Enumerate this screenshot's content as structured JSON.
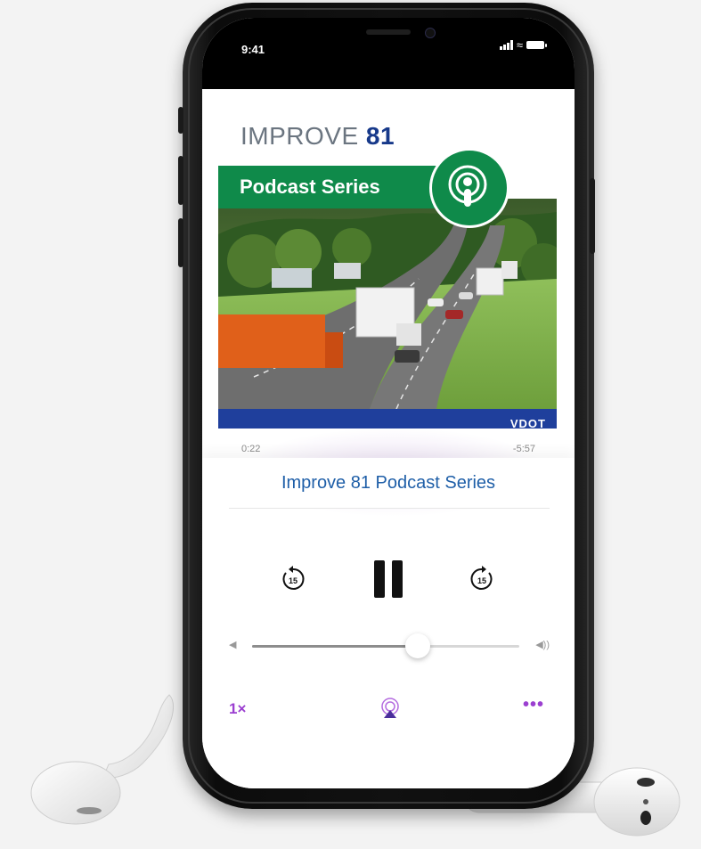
{
  "status_bar": {
    "time": "9:41"
  },
  "artwork": {
    "brand_text": "IMPROVE",
    "brand_number": "81",
    "series_label": "Podcast Series",
    "footer_logo": "VDOT",
    "brand_color": "#17398a",
    "band_color": "#0f8a4a"
  },
  "player": {
    "elapsed": "0:22",
    "remaining": "-5:57",
    "track_title": "Improve 81 Podcast Series",
    "playback_state": "playing",
    "skip_back_seconds": "15",
    "skip_forward_seconds": "15",
    "volume_level": 0.62,
    "speed_label": "1×",
    "accent_color": "#9b3fd0"
  },
  "icons": {
    "skip_back": "skip-back-15-icon",
    "pause": "pause-icon",
    "skip_forward": "skip-forward-15-icon",
    "airplay": "airplay-icon",
    "more": "more-icon",
    "volume_min": "volume-low-icon",
    "volume_max": "volume-high-icon",
    "podcast": "podcast-icon"
  }
}
